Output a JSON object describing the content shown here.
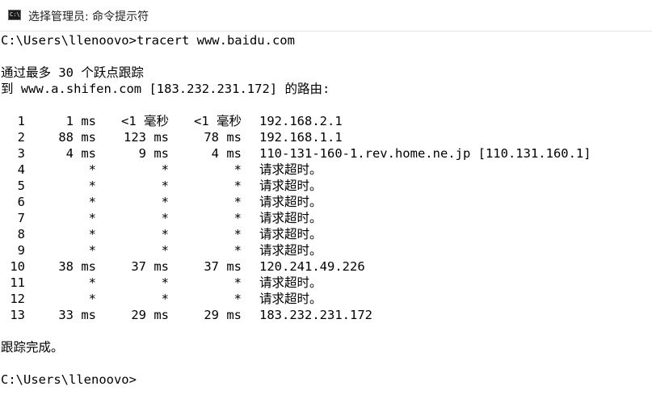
{
  "window": {
    "title": "选择管理员: 命令提示符",
    "icon": "cmd-icon"
  },
  "console": {
    "command_line": "C:\\Users\\llenoovo>tracert www.baidu.com",
    "header_line_1": "通过最多 30 个跃点跟踪",
    "header_line_2": "到 www.a.shifen.com [183.232.231.172] 的路由:",
    "hops": [
      {
        "hop": "1",
        "t1": "1 ms",
        "t2": "<1 毫秒",
        "t3": "<1 毫秒",
        "host": "192.168.2.1"
      },
      {
        "hop": "2",
        "t1": "88 ms",
        "t2": "123 ms",
        "t3": "78 ms",
        "host": "192.168.1.1"
      },
      {
        "hop": "3",
        "t1": "4 ms",
        "t2": "9 ms",
        "t3": "4 ms",
        "host": "110-131-160-1.rev.home.ne.jp [110.131.160.1]"
      },
      {
        "hop": "4",
        "t1": "*",
        "t2": "*",
        "t3": "*",
        "host": "请求超时。"
      },
      {
        "hop": "5",
        "t1": "*",
        "t2": "*",
        "t3": "*",
        "host": "请求超时。"
      },
      {
        "hop": "6",
        "t1": "*",
        "t2": "*",
        "t3": "*",
        "host": "请求超时。"
      },
      {
        "hop": "7",
        "t1": "*",
        "t2": "*",
        "t3": "*",
        "host": "请求超时。"
      },
      {
        "hop": "8",
        "t1": "*",
        "t2": "*",
        "t3": "*",
        "host": "请求超时。"
      },
      {
        "hop": "9",
        "t1": "*",
        "t2": "*",
        "t3": "*",
        "host": "请求超时。"
      },
      {
        "hop": "10",
        "t1": "38 ms",
        "t2": "37 ms",
        "t3": "37 ms",
        "host": "120.241.49.226"
      },
      {
        "hop": "11",
        "t1": "*",
        "t2": "*",
        "t3": "*",
        "host": "请求超时。"
      },
      {
        "hop": "12",
        "t1": "*",
        "t2": "*",
        "t3": "*",
        "host": "请求超时。"
      },
      {
        "hop": "13",
        "t1": "33 ms",
        "t2": "29 ms",
        "t3": "29 ms",
        "host": "183.232.231.172"
      }
    ],
    "trace_complete": "跟踪完成。",
    "prompt": "C:\\Users\\llenoovo>"
  }
}
